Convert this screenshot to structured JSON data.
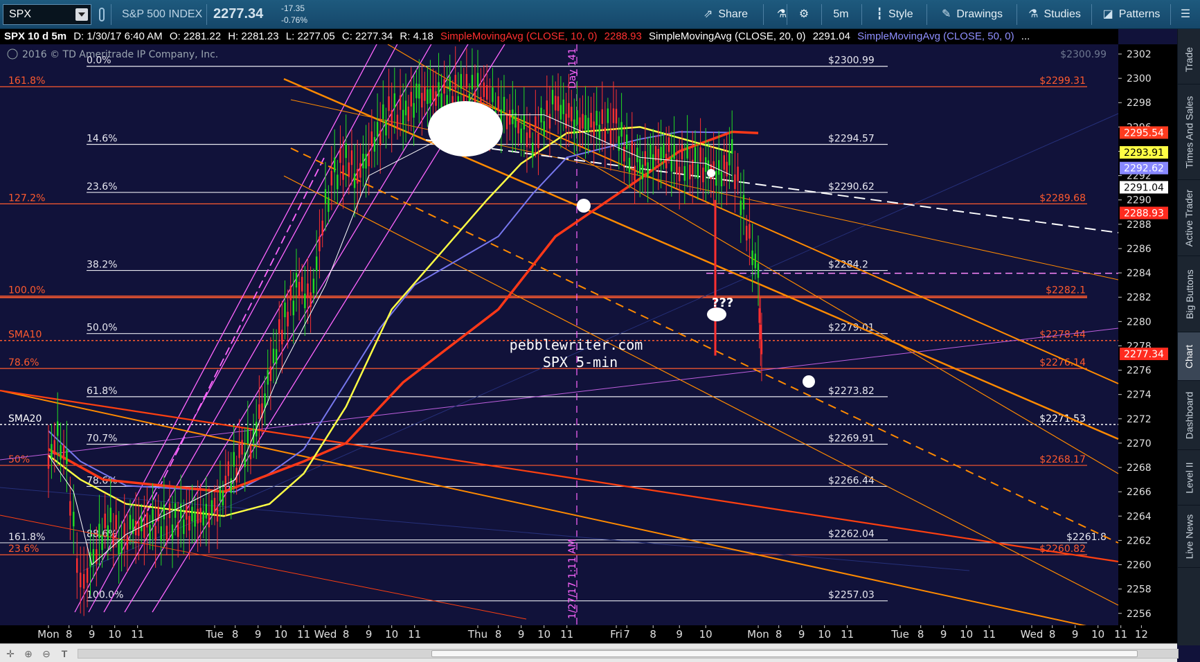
{
  "toolbar": {
    "symbol": "SPX",
    "index_name": "S&P 500 INDEX",
    "last_price": "2277.34",
    "change": "-17.35",
    "change_pct": "-0.76%",
    "share": "Share",
    "interval": "5m",
    "style": "Style",
    "drawings": "Drawings",
    "studies": "Studies",
    "patterns": "Patterns"
  },
  "infoline": {
    "title": "SPX 10 d 5m",
    "date": "D: 1/30/17 6:40 AM",
    "open": "O: 2281.22",
    "high": "H: 2281.23",
    "low": "L: 2277.05",
    "close": "C: 2277.34",
    "range": "R: 4.18",
    "sma10_label": "SimpleMovingAvg (CLOSE, 10, 0)",
    "sma10_value": "2288.93",
    "sma20_label": "SimpleMovingAvg (CLOSE, 20, 0)",
    "sma20_value": "2291.04",
    "sma50_label": "SimpleMovingAvg (CLOSE, 50, 0)",
    "more": "..."
  },
  "copyright": "2016 © TD Ameritrade IP Company, Inc.",
  "side_tabs": [
    "Trade",
    "Times And Sales",
    "Active Trader",
    "Big Buttons",
    "Chart",
    "Dashboard",
    "Level II",
    "Live News"
  ],
  "active_side_tab": "Chart",
  "colors": {
    "background": "#11123a",
    "orange": "#ff8a00",
    "red_fib": "#ff5a2e",
    "magenta": "#ff66ff",
    "yellow": "#ffff44",
    "blue_sma": "#8888ff",
    "toolbar": "#1e5a7e"
  },
  "chart_data": {
    "type": "candlestick",
    "ylim": [
      2255,
      2303
    ],
    "y_ticks": [
      2256,
      2258,
      2260,
      2262,
      2264,
      2266,
      2268,
      2270,
      2272,
      2274,
      2276,
      2278,
      2280,
      2282,
      2284,
      2286,
      2288,
      2290,
      2292,
      2294,
      2296,
      2298,
      2300,
      2302
    ],
    "x_ticks": [
      {
        "label": "Mon",
        "day": 0,
        "hour": 7.6
      },
      {
        "label": "8",
        "day": 0,
        "hour": 8.5
      },
      {
        "label": "9",
        "day": 0,
        "hour": 9.5
      },
      {
        "label": "10",
        "day": 0,
        "hour": 10.5
      },
      {
        "label": "11",
        "day": 0,
        "hour": 11.5
      },
      {
        "label": "Tue",
        "day": 1,
        "hour": 7.6
      },
      {
        "label": "8",
        "day": 1,
        "hour": 8.5
      },
      {
        "label": "9",
        "day": 1,
        "hour": 9.5
      },
      {
        "label": "10",
        "day": 1,
        "hour": 10.5
      },
      {
        "label": "11",
        "day": 1,
        "hour": 11.5
      },
      {
        "label": "Wed",
        "day": 2,
        "hour": 7.6
      },
      {
        "label": "8",
        "day": 2,
        "hour": 8.5
      },
      {
        "label": "9",
        "day": 2,
        "hour": 9.5
      },
      {
        "label": "10",
        "day": 2,
        "hour": 10.5
      },
      {
        "label": "11",
        "day": 2,
        "hour": 11.5
      },
      {
        "label": "Thu",
        "day": 3,
        "hour": 7.6
      },
      {
        "label": "8",
        "day": 3,
        "hour": 8.5
      },
      {
        "label": "9",
        "day": 3,
        "hour": 9.5
      },
      {
        "label": "10",
        "day": 3,
        "hour": 10.5
      },
      {
        "label": "11",
        "day": 3,
        "hour": 11.5
      },
      {
        "label": "Fri",
        "day": 4,
        "hour": 7.6
      },
      {
        "label": "7",
        "day": 4,
        "hour": 8.0
      },
      {
        "label": "8",
        "day": 4,
        "hour": 9.0
      },
      {
        "label": "9",
        "day": 4,
        "hour": 10.0
      },
      {
        "label": "10",
        "day": 4,
        "hour": 11.0
      },
      {
        "label": "Mon",
        "day": 5,
        "hour": 7.6
      },
      {
        "label": "8",
        "day": 5,
        "hour": 8.5
      },
      {
        "label": "9",
        "day": 5,
        "hour": 9.5
      },
      {
        "label": "10",
        "day": 5,
        "hour": 10.5
      },
      {
        "label": "11",
        "day": 5,
        "hour": 11.5
      },
      {
        "label": "Tue",
        "day": 6,
        "hour": 7.6
      },
      {
        "label": "8",
        "day": 6,
        "hour": 8.5
      },
      {
        "label": "9",
        "day": 6,
        "hour": 9.5
      },
      {
        "label": "10",
        "day": 6,
        "hour": 10.5
      },
      {
        "label": "11",
        "day": 6,
        "hour": 11.5
      },
      {
        "label": "Wed",
        "day": 7,
        "hour": 7.6
      },
      {
        "label": "8",
        "day": 7,
        "hour": 8.5
      },
      {
        "label": "9",
        "day": 7,
        "hour": 9.5
      },
      {
        "label": "10",
        "day": 7,
        "hour": 10.5
      },
      {
        "label": "11",
        "day": 7,
        "hour": 11.5
      },
      {
        "label": "12",
        "day": 7,
        "hour": 12.4
      }
    ],
    "fib_white": [
      {
        "label": "0.0%",
        "price": 2300.99,
        "value_label": "$2300.99"
      },
      {
        "label": "14.6%",
        "price": 2294.57,
        "value_label": "$2294.57"
      },
      {
        "label": "23.6%",
        "price": 2290.62,
        "value_label": "$2290.62"
      },
      {
        "label": "38.2%",
        "price": 2284.2,
        "value_label": "$2284.2"
      },
      {
        "label": "50.0%",
        "price": 2279.01,
        "value_label": "$2279.01"
      },
      {
        "label": "61.8%",
        "price": 2273.82,
        "value_label": "$2273.82"
      },
      {
        "label": "70.7%",
        "price": 2269.91,
        "value_label": "$2269.91"
      },
      {
        "label": "78.6%",
        "price": 2266.44,
        "value_label": "$2266.44"
      },
      {
        "label": "88.6%",
        "price": 2262.04,
        "value_label": "$2262.04"
      },
      {
        "label": "100.0%",
        "price": 2257.03,
        "value_label": "$2257.03"
      }
    ],
    "fib_red": [
      {
        "label": "161.8%",
        "price": 2299.31,
        "value_label": "$2299.31"
      },
      {
        "label": "127.2%",
        "price": 2289.68,
        "value_label": "$2289.68"
      },
      {
        "label": "100.0%",
        "price": 2282.1,
        "value_label": "$2282.1"
      },
      {
        "label": "78.6%",
        "price": 2276.14,
        "value_label": "$2276.14"
      },
      {
        "label": "50%",
        "price": 2268.17,
        "value_label": "$2268.17"
      },
      {
        "label": "23.6%",
        "price": 2260.82,
        "value_label": "$2260.82"
      }
    ],
    "fib_white_extra": [
      {
        "label": "161.8%",
        "price": 2261.8,
        "value_label": "$2261.8"
      }
    ],
    "sma_levels": [
      {
        "label": "SMA10",
        "price": 2278.44,
        "value_label": "$2278.44"
      },
      {
        "label": "SMA20",
        "price": 2271.53,
        "value_label": "$2271.53"
      }
    ],
    "overlapped_label": "$2271.53",
    "ghost_label": "$2300.99",
    "price_tags": [
      {
        "value": "2295.54",
        "price": 2295.54,
        "bg": "#ff3b1f",
        "fg": "#ffffff"
      },
      {
        "value": "2293.91",
        "price": 2293.91,
        "bg": "#ffff44",
        "fg": "#000000"
      },
      {
        "value": "2292.62",
        "price": 2292.62,
        "bg": "#8888ff",
        "fg": "#ffffff"
      },
      {
        "value": "2291.04",
        "price": 2291.04,
        "bg": "#ffffff",
        "fg": "#000000"
      },
      {
        "value": "2288.93",
        "price": 2288.93,
        "bg": "#ff2b1f",
        "fg": "#ffffff"
      },
      {
        "value": "2277.34",
        "price": 2277.34,
        "bg": "#ff2b1f",
        "fg": "#ffffff"
      }
    ],
    "annotations": {
      "site": "pebblewriter.com",
      "subtitle": "SPX 5-min",
      "day_label": "Day 141",
      "date_label": "1/27/17 1:11 AM",
      "question": "???"
    },
    "price_path": [
      [
        0,
        7.6,
        2268.5
      ],
      [
        0,
        8.0,
        2270.6
      ],
      [
        0,
        8.4,
        2268.0
      ],
      [
        0,
        8.7,
        2263.0
      ],
      [
        0,
        9.0,
        2258.5
      ],
      [
        0,
        9.3,
        2259.5
      ],
      [
        0,
        9.7,
        2261.5
      ],
      [
        0,
        10.2,
        2263.5
      ],
      [
        0,
        10.8,
        2262.0
      ],
      [
        0,
        11.3,
        2263.0
      ],
      [
        1,
        7.6,
        2264.2
      ],
      [
        1,
        8.2,
        2267.0
      ],
      [
        1,
        8.8,
        2269.0
      ],
      [
        1,
        9.3,
        2270.5
      ],
      [
        1,
        9.8,
        2274.0
      ],
      [
        1,
        10.3,
        2278.0
      ],
      [
        1,
        10.8,
        2281.0
      ],
      [
        1,
        11.3,
        2283.0
      ],
      [
        1,
        11.8,
        2281.5
      ],
      [
        2,
        7.6,
        2289.5
      ],
      [
        2,
        8.0,
        2292.0
      ],
      [
        2,
        8.5,
        2293.5
      ],
      [
        2,
        9.0,
        2292.0
      ],
      [
        2,
        9.5,
        2294.0
      ],
      [
        2,
        10.0,
        2296.0
      ],
      [
        2,
        10.5,
        2297.5
      ],
      [
        2,
        11.0,
        2297.0
      ],
      [
        2,
        11.7,
        2298.5
      ],
      [
        3,
        7.6,
        2299.0
      ],
      [
        3,
        8.0,
        2298.0
      ],
      [
        3,
        8.5,
        2297.5
      ],
      [
        3,
        9.0,
        2297.0
      ],
      [
        3,
        9.5,
        2296.0
      ],
      [
        3,
        10.0,
        2295.0
      ],
      [
        3,
        10.5,
        2296.5
      ],
      [
        3,
        11.0,
        2298.0
      ],
      [
        3,
        11.7,
        2296.5
      ],
      [
        4,
        7.6,
        2296.0
      ],
      [
        4,
        8.0,
        2294.0
      ],
      [
        4,
        8.5,
        2292.5
      ],
      [
        4,
        9.0,
        2293.5
      ],
      [
        4,
        9.5,
        2294.0
      ],
      [
        4,
        10.0,
        2293.0
      ],
      [
        4,
        10.5,
        2293.2
      ],
      [
        4,
        11.0,
        2292.8
      ],
      [
        4,
        11.5,
        2292.0
      ],
      [
        4,
        12.0,
        2293.5
      ],
      [
        5,
        7.6,
        2283.5
      ],
      [
        5,
        7.7,
        2279.0
      ],
      [
        5,
        7.8,
        2277.34
      ]
    ],
    "sma50_path": [
      [
        0,
        7.6,
        2271.0
      ],
      [
        0,
        9.0,
        2268.5
      ],
      [
        0,
        11.0,
        2266.5
      ],
      [
        1,
        8.5,
        2266.0
      ],
      [
        1,
        10.0,
        2267.5
      ],
      [
        1,
        11.5,
        2269.5
      ],
      [
        2,
        8.5,
        2275.0
      ],
      [
        2,
        10.0,
        2279.5
      ],
      [
        2,
        11.5,
        2283.0
      ],
      [
        3,
        8.5,
        2287.0
      ],
      [
        3,
        10.0,
        2290.5
      ],
      [
        3,
        11.5,
        2293.5
      ],
      [
        4,
        8.5,
        2295.0
      ],
      [
        4,
        10.0,
        2295.6
      ],
      [
        4,
        12.0,
        2295.54
      ]
    ]
  }
}
